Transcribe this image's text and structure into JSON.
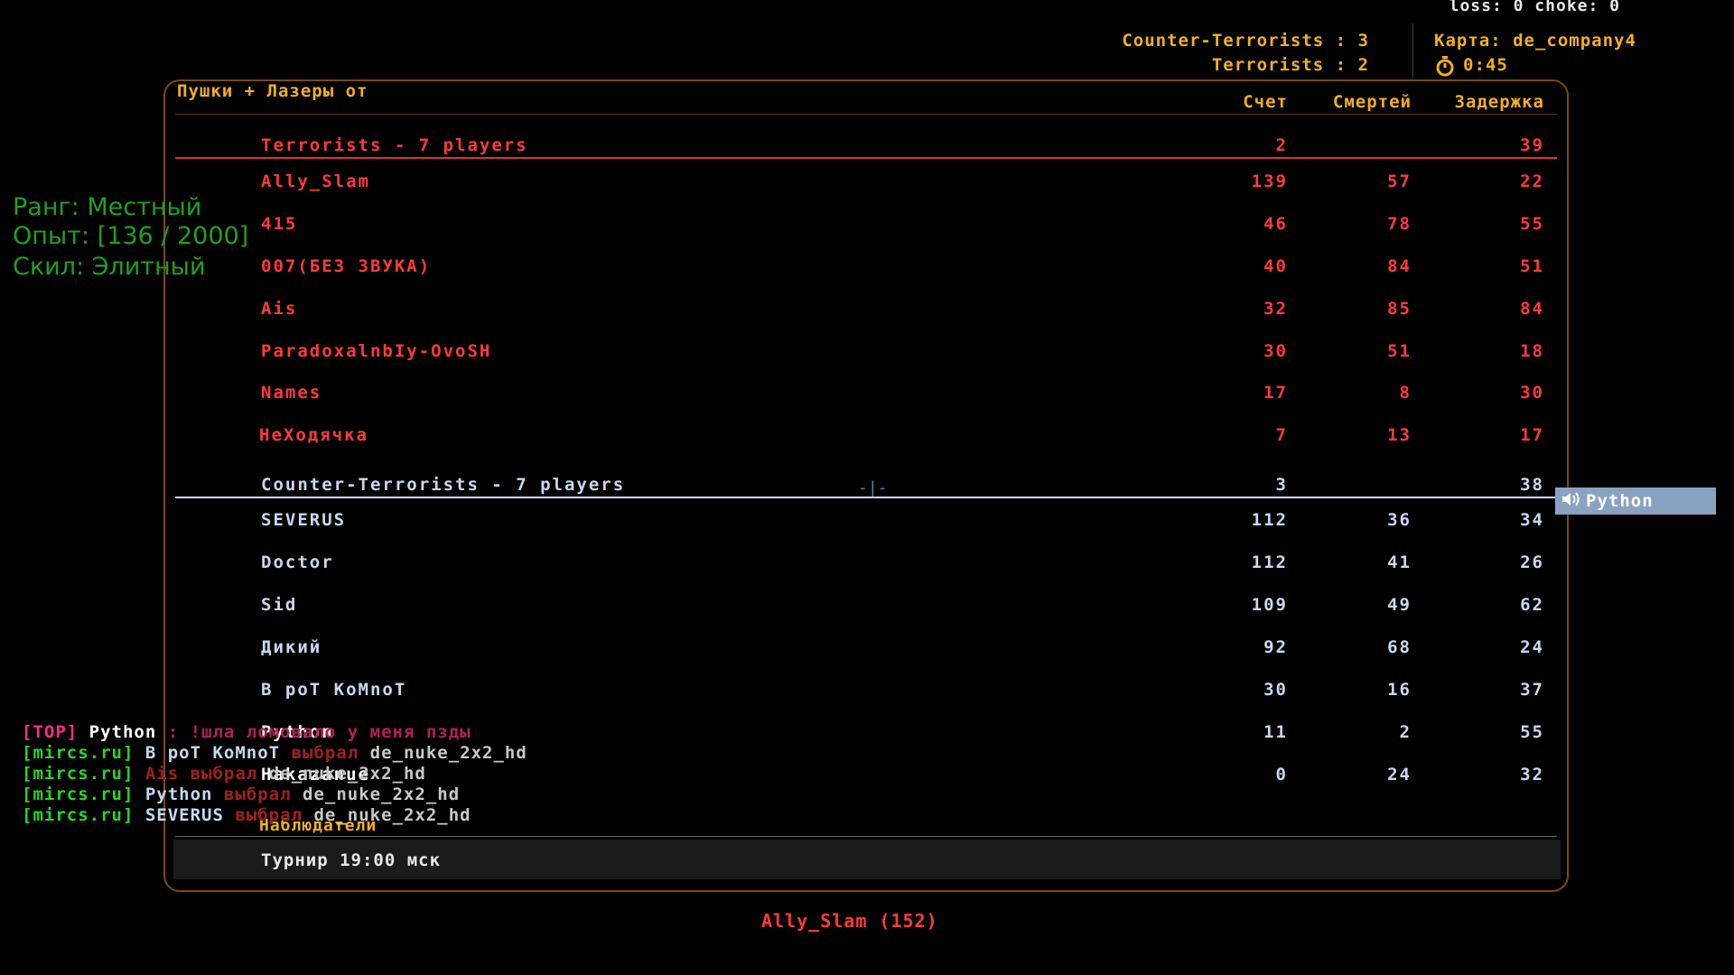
{
  "hud": {
    "net_stats": "loss: 0 choke:  0",
    "ct_score": "Counter-Terrorists : 3",
    "t_score": "Terrorists : 2",
    "map": "Карта: de_company4",
    "timer": "0:45",
    "timer_icon": "stopwatch-icon"
  },
  "scoreboard": {
    "server_name": "Пушки + Лазеры от",
    "headers": {
      "score": "Счет",
      "deaths": "Смертей",
      "ping": "Задержка"
    },
    "terrorists": {
      "title": "Terrorists   -   7 players",
      "score": "2",
      "ping": "39",
      "players": [
        {
          "name": "Ally_Slam",
          "score": "139",
          "deaths": "57",
          "ping": "22"
        },
        {
          "name": "415",
          "score": "46",
          "deaths": "78",
          "ping": "55"
        },
        {
          "name": "007(БЕЗ ЗВУКА)",
          "score": "40",
          "deaths": "84",
          "ping": "51"
        },
        {
          "name": "Ais",
          "score": "32",
          "deaths": "85",
          "ping": "84"
        },
        {
          "name": "ParadoxalnbIy-OvoSH",
          "score": "30",
          "deaths": "51",
          "ping": "18"
        },
        {
          "name": "Names",
          "score": "17",
          "deaths": "8",
          "ping": "30"
        },
        {
          "name": "НеХодячка",
          "score": "7",
          "deaths": "13",
          "ping": "17"
        }
      ]
    },
    "counter_terrorists": {
      "title": "Counter-Terrorists   -   7 players",
      "score": "3",
      "ping": "38",
      "players": [
        {
          "name": "SEVERUS",
          "score": "112",
          "deaths": "36",
          "ping": "34"
        },
        {
          "name": "Doctor",
          "score": "112",
          "deaths": "41",
          "ping": "26"
        },
        {
          "name": "Sid",
          "score": "109",
          "deaths": "49",
          "ping": "62"
        },
        {
          "name": "Дикий",
          "score": "92",
          "deaths": "68",
          "ping": "24"
        },
        {
          "name": "B poT KoMnoT",
          "score": "30",
          "deaths": "16",
          "ping": "37"
        },
        {
          "name": "Python",
          "score": "11",
          "deaths": "2",
          "ping": "55"
        },
        {
          "name": "Hakazanue",
          "score": "0",
          "deaths": "24",
          "ping": "32"
        }
      ]
    },
    "spectators_title": "Наблюдатели",
    "spectators_text": "Турнир 19:00 мск"
  },
  "rank_panel": {
    "rank": "Ранг: Местный",
    "exp": "Опыт: [136 / 2000]",
    "skill": "Скил: Элитный"
  },
  "voice": {
    "icon": "speaker-icon",
    "name": "Python"
  },
  "chat": [
    {
      "tag": "[TOP]",
      "name": "Python",
      "text": " : !шла ломовало у меня пзды"
    },
    {
      "tag": "[mircs.ru]",
      "name": "B poT KoMnoT",
      "text": " выбрал ",
      "map": "de_nuke_2x2_hd"
    },
    {
      "tag": "[mircs.ru]",
      "name": "Ais",
      "text": " выбрал ",
      "map": "de_nuke_2x2_hd"
    },
    {
      "tag": "[mircs.ru]",
      "name": "Python",
      "text": " выбрал ",
      "map": "de_nuke_2x2_hd"
    },
    {
      "tag": "[mircs.ru]",
      "name": "SEVERUS",
      "text": " выбрал ",
      "map": "de_nuke_2x2_hd"
    }
  ],
  "spectating": "Ally_Slam (152)",
  "colors": {
    "terrorist": "#ff3a3a",
    "ct": "#c8d8f0",
    "accent": "#f2b01e",
    "rank": "#1fa01f"
  }
}
